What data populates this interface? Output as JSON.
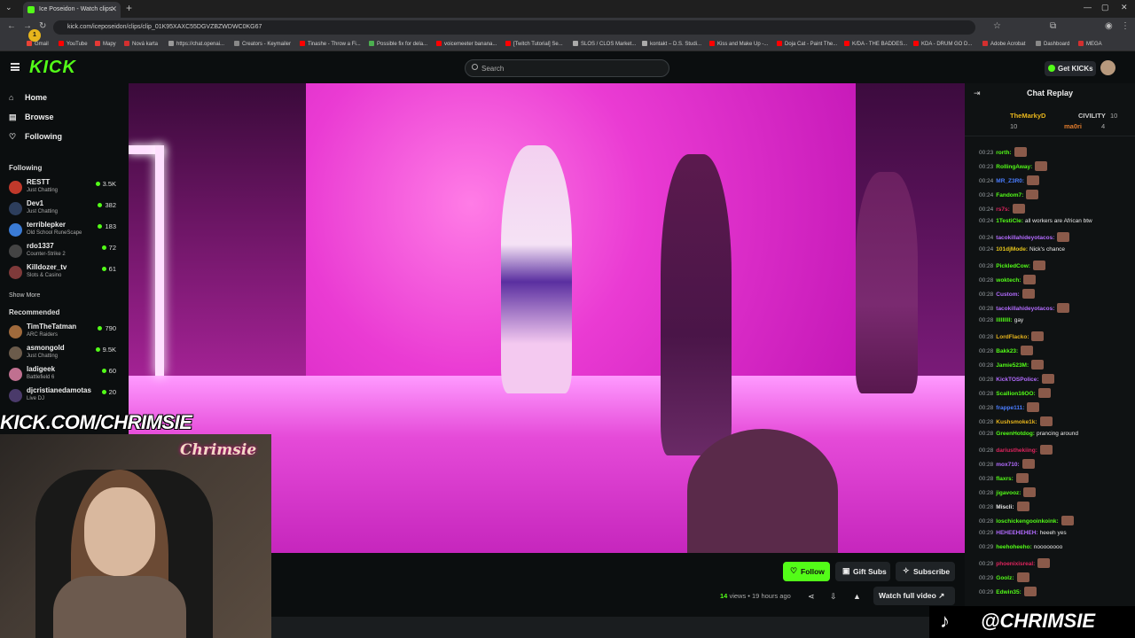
{
  "browser": {
    "tab_title": "Ice Poseidon - Watch clips",
    "url": "kick.com/iceposeidon/clips/clip_01K95XAXC55DGVZBZWDWC0KG67",
    "bookmarks": [
      "Gmail",
      "YouTube",
      "Mapy",
      "Nová karta",
      "https://chat.openai...",
      "Creators - Keymailer",
      "Tinashe - Throw a Fi...",
      "Possible fix for dela...",
      "voicemeeter banana...",
      "[Twitch Tutorial] Se...",
      "SLOS / CLOS Market...",
      "kontakt – D.S. Studi...",
      "Kiss and Make Up -...",
      "Doja Cat - Paint The...",
      "K/DA - THE BADDES...",
      "KDA - DRUM GO D...",
      "Adobe Acrobat",
      "Dashboard",
      "MEGA"
    ]
  },
  "header": {
    "logo": "KICK",
    "search_placeholder": "Search",
    "get_kicks": "Get KICKs"
  },
  "sidebar": {
    "nav": [
      {
        "label": "Home",
        "icon": "home-icon"
      },
      {
        "label": "Browse",
        "icon": "browse-icon"
      },
      {
        "label": "Following",
        "icon": "heart-icon"
      }
    ],
    "following_title": "Following",
    "following": [
      {
        "name": "RESTT",
        "category": "Just Chatting",
        "viewers": "3.5K",
        "color": "#c0392b"
      },
      {
        "name": "Dev1",
        "category": "Just Chatting",
        "viewers": "382",
        "color": "#2d3e5c"
      },
      {
        "name": "terriblepker",
        "category": "Old School RuneScape",
        "viewers": "183",
        "color": "#3a7bd5"
      },
      {
        "name": "rdo1337",
        "category": "Counter-Strike 2",
        "viewers": "72",
        "color": "#444"
      },
      {
        "name": "Killdozer_tv",
        "category": "Slots & Casino",
        "viewers": "61",
        "color": "#7f3a3a"
      }
    ],
    "show_more": "Show More",
    "recommended_title": "Recommended",
    "recommended": [
      {
        "name": "TimTheTatman",
        "category": "ARC Raiders",
        "viewers": "790",
        "color": "#a06a3c"
      },
      {
        "name": "asmongold",
        "category": "Just Chatting",
        "viewers": "9.5K",
        "color": "#6b5b4b"
      },
      {
        "name": "ladigeek",
        "category": "Battlefield 6",
        "viewers": "60",
        "color": "#c07090"
      },
      {
        "name": "djcristianedamotas",
        "category": "Live DJ",
        "viewers": "20",
        "color": "#4a3a6a"
      }
    ]
  },
  "stream_overlay": {
    "brand": "KICK.COM/CHRIMSIE",
    "cam_label": "Chrimsie",
    "handle": "@CHRIMSIE"
  },
  "clip": {
    "follow": "Follow",
    "gift_subs": "Gift Subs",
    "subscribe": "Subscribe",
    "views_count": "14",
    "views_label": "views",
    "age": "19 hours ago",
    "watch_full": "Watch full video"
  },
  "chat": {
    "title": "Chat Replay",
    "pinned": [
      {
        "name": "TheMarkyD",
        "count": "10",
        "color": "#e7b51c"
      },
      {
        "name": "CIVILITY",
        "count": "10",
        "color": "#cfcfcf"
      },
      {
        "name": "ma0ri",
        "count": "4",
        "color": "#e07b2c"
      }
    ],
    "messages": [
      {
        "time": "00:23",
        "user": "rorth:",
        "color": "#53fc18",
        "text": ""
      },
      {
        "time": "00:23",
        "user": "RollingAway:",
        "color": "#53fc18",
        "text": ""
      },
      {
        "time": "00:24",
        "user": "MR_Z3R0:",
        "color": "#4a7dff",
        "text": ""
      },
      {
        "time": "00:24",
        "user": "Fandom7:",
        "color": "#53fc18",
        "text": ""
      },
      {
        "time": "00:24",
        "user": "rs7s:",
        "color": "#e0245e",
        "text": ""
      },
      {
        "time": "00:24",
        "user": "1TestiCle:",
        "color": "#53fc18",
        "text": "all workers are African btw"
      },
      {
        "time": "00:24",
        "user": "tacokillahideyotacos:",
        "color": "#b36bff",
        "text": ""
      },
      {
        "time": "00:24",
        "user": "101djMode:",
        "color": "#e7c61c",
        "text": "Nick's chance"
      },
      {
        "time": "00:28",
        "user": "PickledCow:",
        "color": "#53fc18",
        "text": ""
      },
      {
        "time": "00:28",
        "user": "woktech:",
        "color": "#53fc18",
        "text": ""
      },
      {
        "time": "00:28",
        "user": "Custom:",
        "color": "#b36bff",
        "text": ""
      },
      {
        "time": "00:28",
        "user": "tacokillahideyotacos:",
        "color": "#b36bff",
        "text": ""
      },
      {
        "time": "00:28",
        "user": "lllllllll:",
        "color": "#53fc18",
        "text": "gay"
      },
      {
        "time": "00:28",
        "user": "LordFlacko:",
        "color": "#e7b51c",
        "text": ""
      },
      {
        "time": "00:28",
        "user": "Bakk23:",
        "color": "#53fc18",
        "text": ""
      },
      {
        "time": "00:28",
        "user": "Jamie523M:",
        "color": "#53fc18",
        "text": ""
      },
      {
        "time": "00:28",
        "user": "KickTOSPolice:",
        "color": "#b36bff",
        "text": ""
      },
      {
        "time": "00:28",
        "user": "Scallion16OO:",
        "color": "#53fc18",
        "text": ""
      },
      {
        "time": "00:28",
        "user": "frappe111:",
        "color": "#4a7dff",
        "text": ""
      },
      {
        "time": "00:28",
        "user": "Kushsmoke1k:",
        "color": "#e7b51c",
        "text": ""
      },
      {
        "time": "00:28",
        "user": "GreenHotdog:",
        "color": "#53fc18",
        "text": "prancing around"
      },
      {
        "time": "00:28",
        "user": "dariusthekiing:",
        "color": "#e0245e",
        "text": ""
      },
      {
        "time": "00:28",
        "user": "mox710:",
        "color": "#b36bff",
        "text": ""
      },
      {
        "time": "00:28",
        "user": "flaxrs:",
        "color": "#53fc18",
        "text": ""
      },
      {
        "time": "00:28",
        "user": "jigavooz:",
        "color": "#53fc18",
        "text": ""
      },
      {
        "time": "00:28",
        "user": "Miscli:",
        "color": "#e8e8e8",
        "text": ""
      },
      {
        "time": "00:28",
        "user": "loschickengooinkoink:",
        "color": "#53fc18",
        "text": ""
      },
      {
        "time": "00:29",
        "user": "HEHEEHEHEH:",
        "color": "#b36bff",
        "text": "heeeh yes"
      },
      {
        "time": "00:29",
        "user": "heehoheeho:",
        "color": "#53fc18",
        "text": "noooooooo"
      },
      {
        "time": "00:29",
        "user": "phoenixisreal:",
        "color": "#e0245e",
        "text": ""
      },
      {
        "time": "00:29",
        "user": "Goolz:",
        "color": "#53fc18",
        "text": ""
      },
      {
        "time": "00:29",
        "user": "Edwin35:",
        "color": "#53fc18",
        "text": ""
      }
    ]
  }
}
